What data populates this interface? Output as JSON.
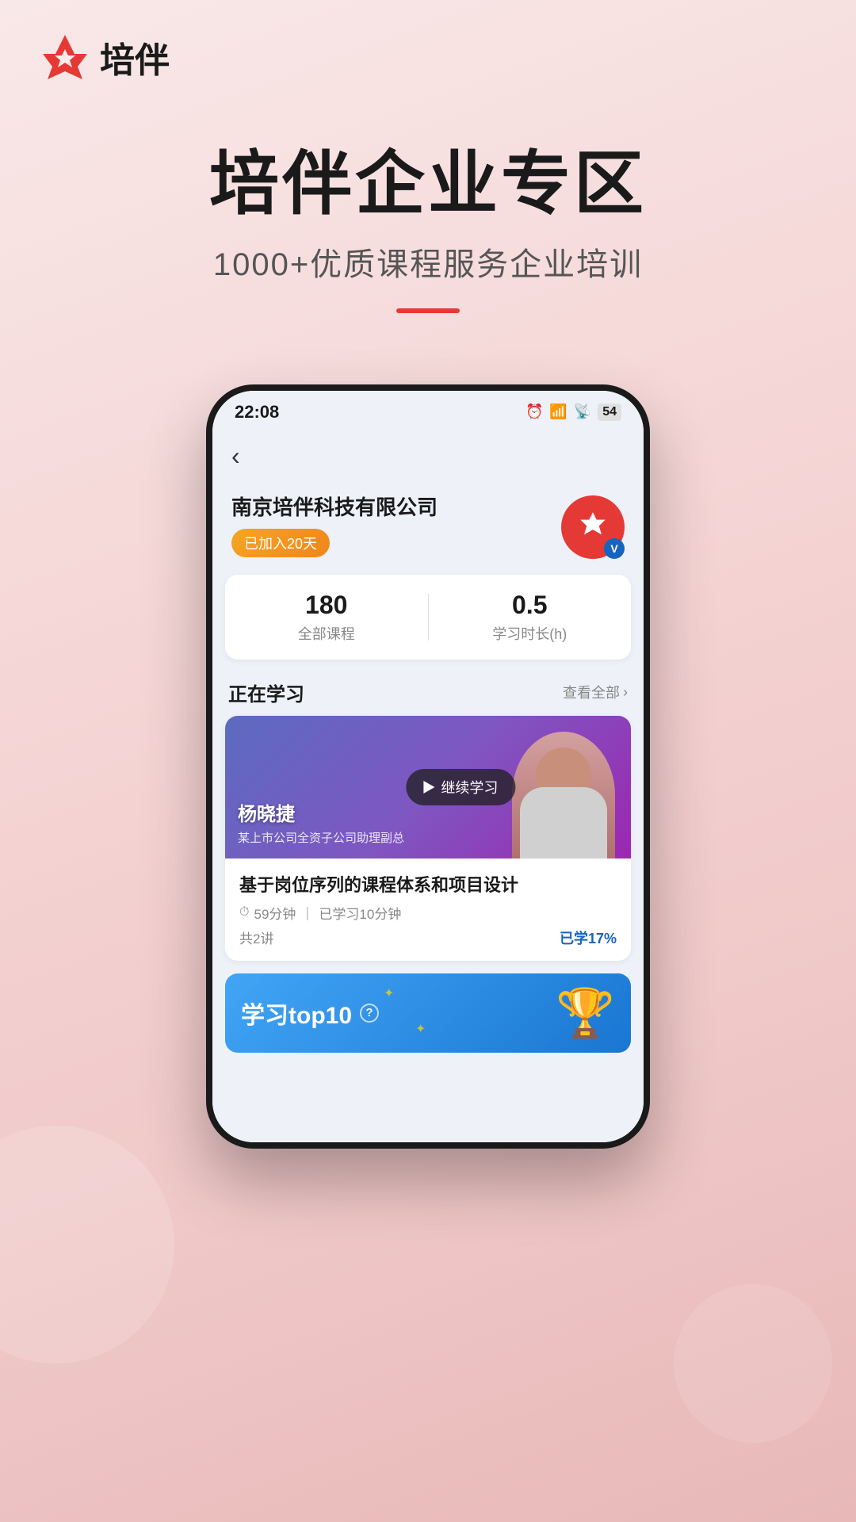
{
  "app": {
    "logo_text": "培伴",
    "status_bar": {
      "time": "22:08",
      "battery": "54"
    }
  },
  "hero": {
    "title": "培伴企业专区",
    "subtitle": "1000+优质课程服务企业培训"
  },
  "company": {
    "name": "南京培伴科技有限公司",
    "joined_badge": "已加入20天",
    "verify_label": "V"
  },
  "stats": {
    "courses_value": "180",
    "courses_label": "全部课程",
    "hours_value": "0.5",
    "hours_label": "学习时长(h)"
  },
  "currently_learning": {
    "section_title": "正在学习",
    "more_label": "查看全部",
    "course": {
      "instructor_name": "杨晓捷",
      "instructor_title": "某上市公司全资子公司助理副总",
      "continue_btn": "继续学习",
      "title": "基于岗位序列的课程体系和项目设计",
      "duration": "59分钟",
      "studied": "已学习10分钟",
      "lessons": "共2讲",
      "progress": "已学17%"
    }
  },
  "top10": {
    "title": "学习top10",
    "help_label": "?"
  },
  "nav": {
    "back_label": "‹"
  }
}
